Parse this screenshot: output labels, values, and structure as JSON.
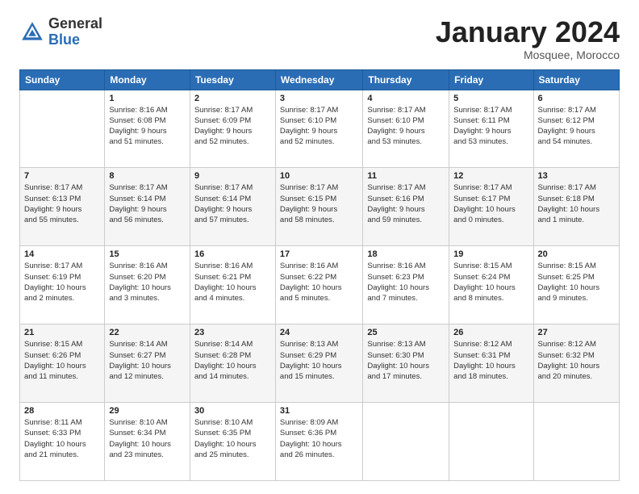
{
  "logo": {
    "general": "General",
    "blue": "Blue"
  },
  "title": "January 2024",
  "location": "Mosquee, Morocco",
  "days_header": [
    "Sunday",
    "Monday",
    "Tuesday",
    "Wednesday",
    "Thursday",
    "Friday",
    "Saturday"
  ],
  "weeks": [
    [
      {
        "day": "",
        "content": ""
      },
      {
        "day": "1",
        "content": "Sunrise: 8:16 AM\nSunset: 6:08 PM\nDaylight: 9 hours\nand 51 minutes."
      },
      {
        "day": "2",
        "content": "Sunrise: 8:17 AM\nSunset: 6:09 PM\nDaylight: 9 hours\nand 52 minutes."
      },
      {
        "day": "3",
        "content": "Sunrise: 8:17 AM\nSunset: 6:10 PM\nDaylight: 9 hours\nand 52 minutes."
      },
      {
        "day": "4",
        "content": "Sunrise: 8:17 AM\nSunset: 6:10 PM\nDaylight: 9 hours\nand 53 minutes."
      },
      {
        "day": "5",
        "content": "Sunrise: 8:17 AM\nSunset: 6:11 PM\nDaylight: 9 hours\nand 53 minutes."
      },
      {
        "day": "6",
        "content": "Sunrise: 8:17 AM\nSunset: 6:12 PM\nDaylight: 9 hours\nand 54 minutes."
      }
    ],
    [
      {
        "day": "7",
        "content": "Sunrise: 8:17 AM\nSunset: 6:13 PM\nDaylight: 9 hours\nand 55 minutes."
      },
      {
        "day": "8",
        "content": "Sunrise: 8:17 AM\nSunset: 6:14 PM\nDaylight: 9 hours\nand 56 minutes."
      },
      {
        "day": "9",
        "content": "Sunrise: 8:17 AM\nSunset: 6:14 PM\nDaylight: 9 hours\nand 57 minutes."
      },
      {
        "day": "10",
        "content": "Sunrise: 8:17 AM\nSunset: 6:15 PM\nDaylight: 9 hours\nand 58 minutes."
      },
      {
        "day": "11",
        "content": "Sunrise: 8:17 AM\nSunset: 6:16 PM\nDaylight: 9 hours\nand 59 minutes."
      },
      {
        "day": "12",
        "content": "Sunrise: 8:17 AM\nSunset: 6:17 PM\nDaylight: 10 hours\nand 0 minutes."
      },
      {
        "day": "13",
        "content": "Sunrise: 8:17 AM\nSunset: 6:18 PM\nDaylight: 10 hours\nand 1 minute."
      }
    ],
    [
      {
        "day": "14",
        "content": "Sunrise: 8:17 AM\nSunset: 6:19 PM\nDaylight: 10 hours\nand 2 minutes."
      },
      {
        "day": "15",
        "content": "Sunrise: 8:16 AM\nSunset: 6:20 PM\nDaylight: 10 hours\nand 3 minutes."
      },
      {
        "day": "16",
        "content": "Sunrise: 8:16 AM\nSunset: 6:21 PM\nDaylight: 10 hours\nand 4 minutes."
      },
      {
        "day": "17",
        "content": "Sunrise: 8:16 AM\nSunset: 6:22 PM\nDaylight: 10 hours\nand 5 minutes."
      },
      {
        "day": "18",
        "content": "Sunrise: 8:16 AM\nSunset: 6:23 PM\nDaylight: 10 hours\nand 7 minutes."
      },
      {
        "day": "19",
        "content": "Sunrise: 8:15 AM\nSunset: 6:24 PM\nDaylight: 10 hours\nand 8 minutes."
      },
      {
        "day": "20",
        "content": "Sunrise: 8:15 AM\nSunset: 6:25 PM\nDaylight: 10 hours\nand 9 minutes."
      }
    ],
    [
      {
        "day": "21",
        "content": "Sunrise: 8:15 AM\nSunset: 6:26 PM\nDaylight: 10 hours\nand 11 minutes."
      },
      {
        "day": "22",
        "content": "Sunrise: 8:14 AM\nSunset: 6:27 PM\nDaylight: 10 hours\nand 12 minutes."
      },
      {
        "day": "23",
        "content": "Sunrise: 8:14 AM\nSunset: 6:28 PM\nDaylight: 10 hours\nand 14 minutes."
      },
      {
        "day": "24",
        "content": "Sunrise: 8:13 AM\nSunset: 6:29 PM\nDaylight: 10 hours\nand 15 minutes."
      },
      {
        "day": "25",
        "content": "Sunrise: 8:13 AM\nSunset: 6:30 PM\nDaylight: 10 hours\nand 17 minutes."
      },
      {
        "day": "26",
        "content": "Sunrise: 8:12 AM\nSunset: 6:31 PM\nDaylight: 10 hours\nand 18 minutes."
      },
      {
        "day": "27",
        "content": "Sunrise: 8:12 AM\nSunset: 6:32 PM\nDaylight: 10 hours\nand 20 minutes."
      }
    ],
    [
      {
        "day": "28",
        "content": "Sunrise: 8:11 AM\nSunset: 6:33 PM\nDaylight: 10 hours\nand 21 minutes."
      },
      {
        "day": "29",
        "content": "Sunrise: 8:10 AM\nSunset: 6:34 PM\nDaylight: 10 hours\nand 23 minutes."
      },
      {
        "day": "30",
        "content": "Sunrise: 8:10 AM\nSunset: 6:35 PM\nDaylight: 10 hours\nand 25 minutes."
      },
      {
        "day": "31",
        "content": "Sunrise: 8:09 AM\nSunset: 6:36 PM\nDaylight: 10 hours\nand 26 minutes."
      },
      {
        "day": "",
        "content": ""
      },
      {
        "day": "",
        "content": ""
      },
      {
        "day": "",
        "content": ""
      }
    ]
  ]
}
